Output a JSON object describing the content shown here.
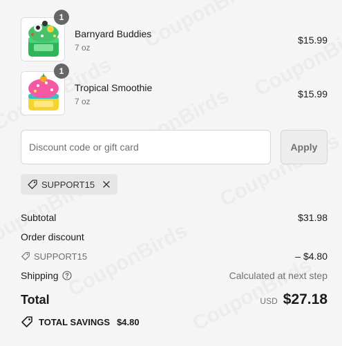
{
  "cart": {
    "items": [
      {
        "name": "Barnyard Buddies",
        "variant": "7 oz",
        "price": "$15.99",
        "quantity": "1",
        "image_icon": "slime-container-green-icon"
      },
      {
        "name": "Tropical Smoothie",
        "variant": "7 oz",
        "price": "$15.99",
        "quantity": "1",
        "image_icon": "slime-container-pink-yellow-icon"
      }
    ]
  },
  "discount": {
    "placeholder": "Discount code or gift card",
    "value": "",
    "apply_label": "Apply",
    "applied_code": "SUPPORT15"
  },
  "summary": {
    "subtotal_label": "Subtotal",
    "subtotal_value": "$31.98",
    "order_discount_label": "Order discount",
    "discount_code": "SUPPORT15",
    "discount_value": "– $4.80",
    "shipping_label": "Shipping",
    "shipping_value": "Calculated at next step",
    "total_label": "Total",
    "currency": "USD",
    "total_value": "$27.18",
    "savings_label": "TOTAL SAVINGS",
    "savings_value": "$4.80"
  },
  "watermark": {
    "text": "CouponBirds"
  },
  "colors": {
    "page_background": "#f5f5f5",
    "badge": "#666666",
    "text_primary": "#1a1a1a",
    "text_muted": "#707070",
    "tag_background": "#e6e6e6"
  }
}
